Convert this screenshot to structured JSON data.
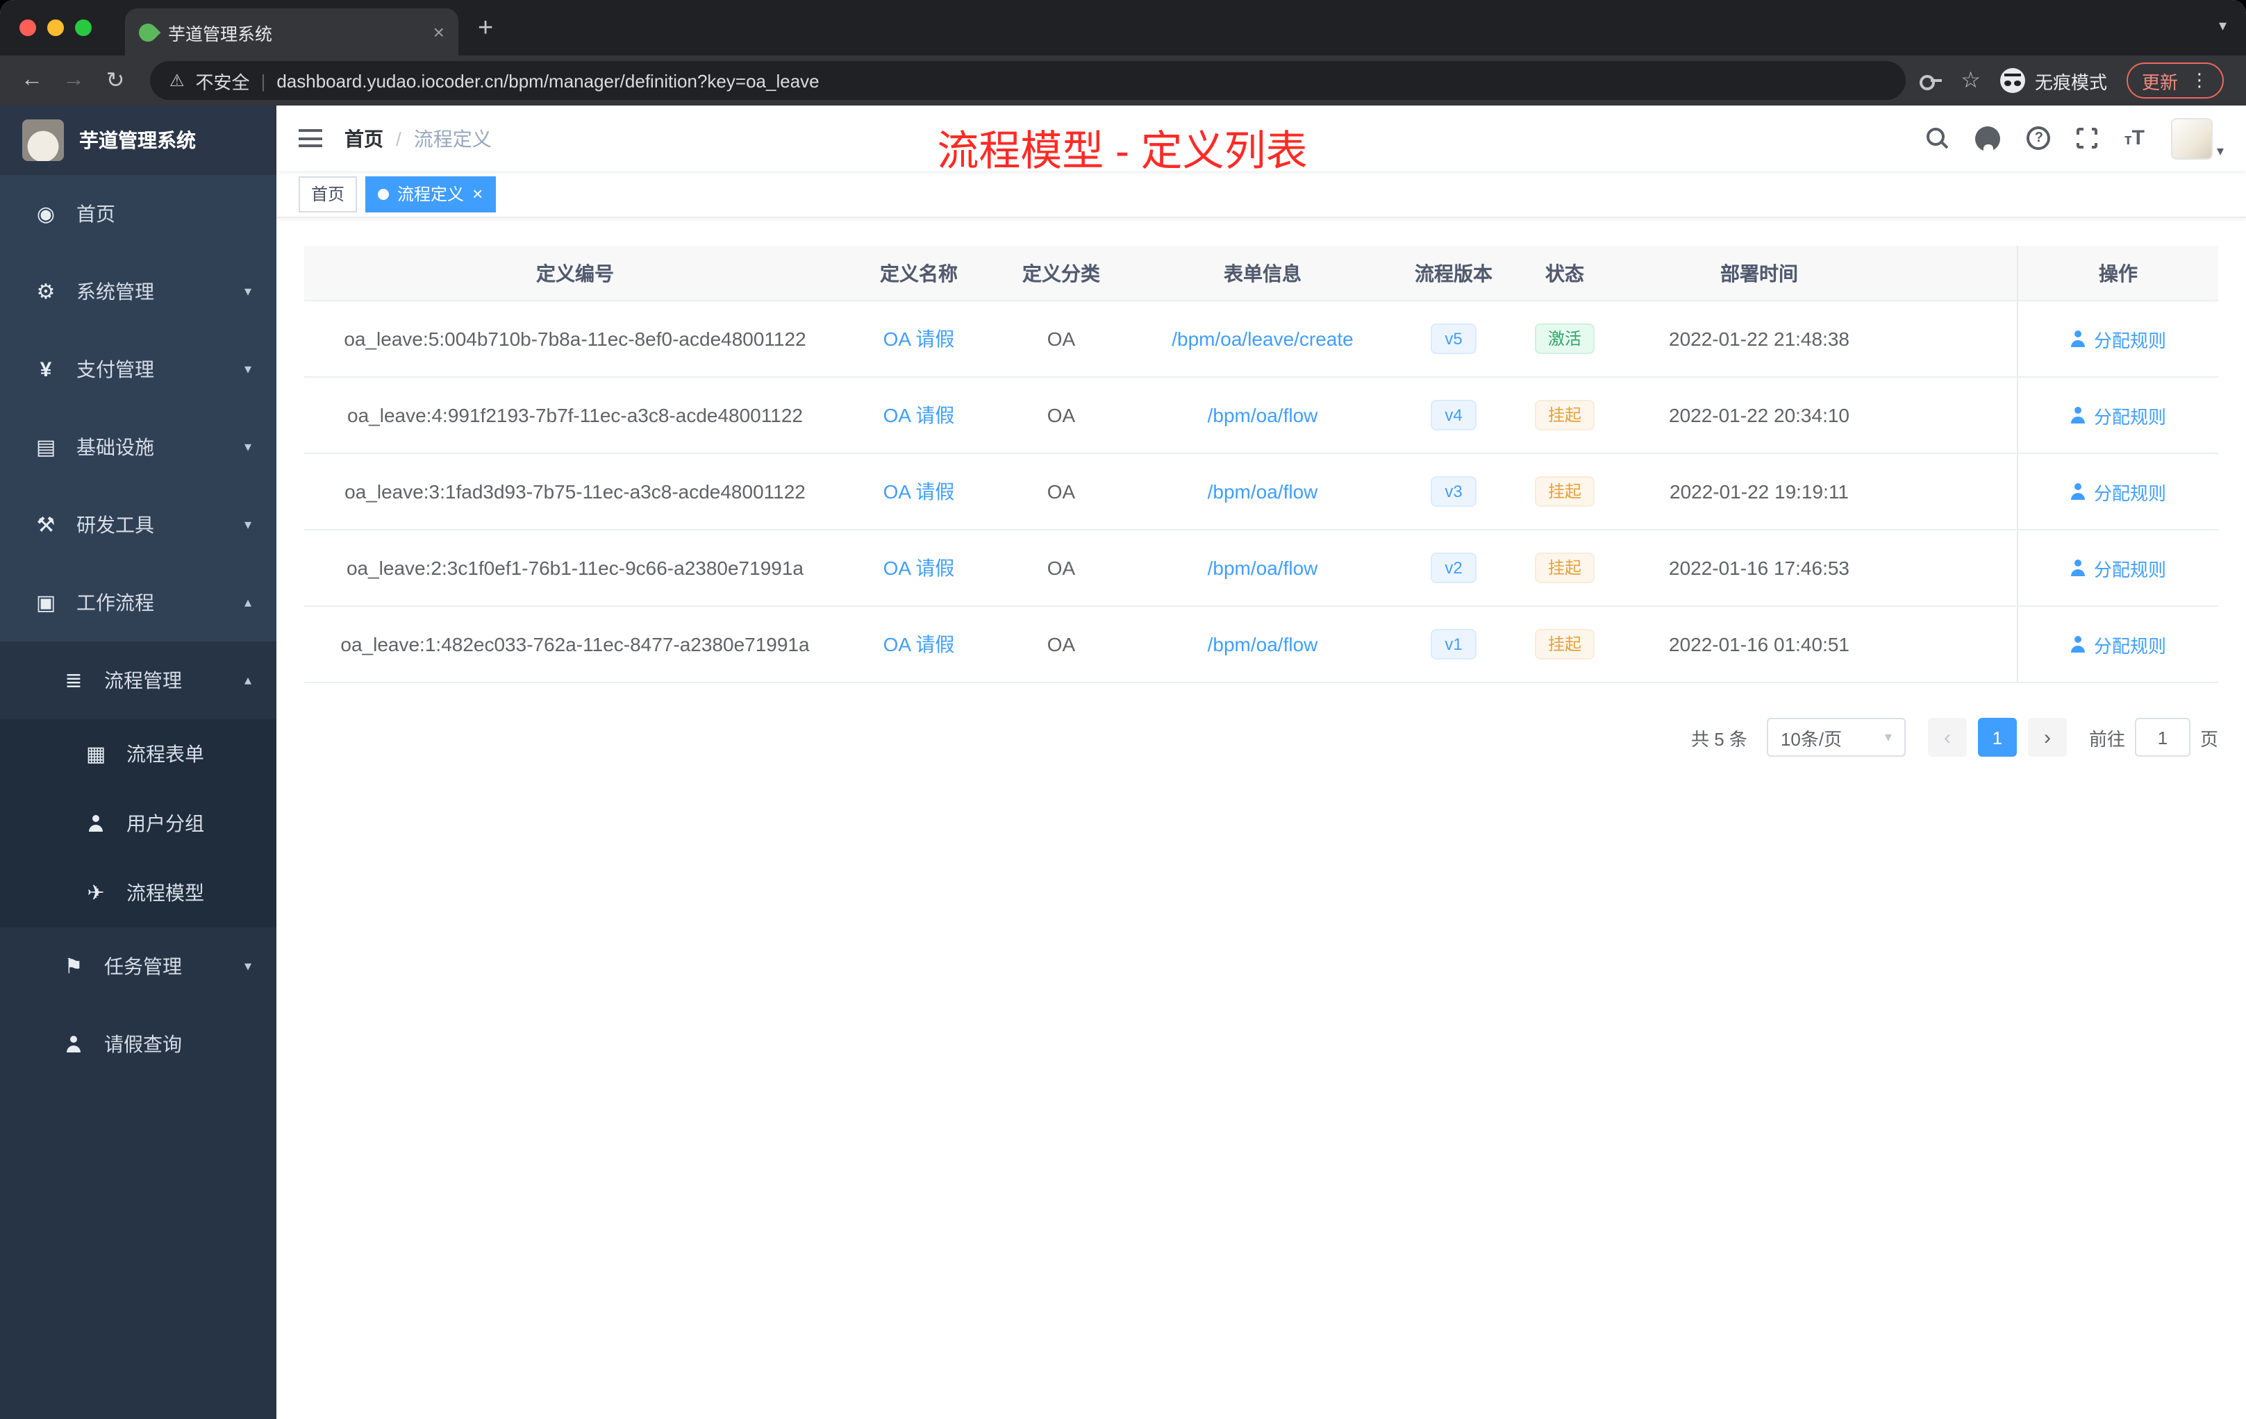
{
  "colors": {
    "accent": "#409eff",
    "success": "#2da768",
    "warning": "#e6a23c",
    "annotation": "#fe2b25",
    "sidebar_bg": "#304156"
  },
  "browser": {
    "tab_title": "芋道管理系统",
    "security_label": "不安全",
    "url": "dashboard.yudao.iocoder.cn/bpm/manager/definition?key=oa_leave",
    "incognito_label": "无痕模式",
    "update_label": "更新"
  },
  "sidebar": {
    "logo_title": "芋道管理系统",
    "items": [
      {
        "label": "首页"
      },
      {
        "label": "系统管理"
      },
      {
        "label": "支付管理"
      },
      {
        "label": "基础设施"
      },
      {
        "label": "研发工具"
      },
      {
        "label": "工作流程"
      },
      {
        "label": "流程管理"
      },
      {
        "label": "流程表单"
      },
      {
        "label": "用户分组"
      },
      {
        "label": "流程模型"
      },
      {
        "label": "任务管理"
      },
      {
        "label": "请假查询"
      }
    ]
  },
  "header": {
    "breadcrumb_home": "首页",
    "breadcrumb_sep": "/",
    "breadcrumb_current": "流程定义",
    "annotation": "流程模型 - 定义列表"
  },
  "tags": {
    "home": "首页",
    "current": "流程定义"
  },
  "table": {
    "columns": {
      "id": "定义编号",
      "name": "定义名称",
      "category": "定义分类",
      "form": "表单信息",
      "version": "流程版本",
      "status": "状态",
      "time": "部署时间",
      "action": "操作"
    },
    "rows": [
      {
        "id": "oa_leave:5:004b710b-7b8a-11ec-8ef0-acde48001122",
        "name": "OA 请假",
        "category": "OA",
        "form": "/bpm/oa/leave/create",
        "version": "v5",
        "status": "激活",
        "time": "2022-01-22 21:48:38",
        "action": "分配规则"
      },
      {
        "id": "oa_leave:4:991f2193-7b7f-11ec-a3c8-acde48001122",
        "name": "OA 请假",
        "category": "OA",
        "form": "/bpm/oa/flow",
        "version": "v4",
        "status": "挂起",
        "time": "2022-01-22 20:34:10",
        "action": "分配规则"
      },
      {
        "id": "oa_leave:3:1fad3d93-7b75-11ec-a3c8-acde48001122",
        "name": "OA 请假",
        "category": "OA",
        "form": "/bpm/oa/flow",
        "version": "v3",
        "status": "挂起",
        "time": "2022-01-22 19:19:11",
        "action": "分配规则"
      },
      {
        "id": "oa_leave:2:3c1f0ef1-76b1-11ec-9c66-a2380e71991a",
        "name": "OA 请假",
        "category": "OA",
        "form": "/bpm/oa/flow",
        "version": "v2",
        "status": "挂起",
        "time": "2022-01-16 17:46:53",
        "action": "分配规则"
      },
      {
        "id": "oa_leave:1:482ec033-762a-11ec-8477-a2380e71991a",
        "name": "OA 请假",
        "category": "OA",
        "form": "/bpm/oa/flow",
        "version": "v1",
        "status": "挂起",
        "time": "2022-01-16 01:40:51",
        "action": "分配规则"
      }
    ]
  },
  "pagination": {
    "total": "共 5 条",
    "size": "10条/页",
    "page": "1",
    "goto_prefix": "前往",
    "goto_value": "1",
    "goto_suffix": "页"
  }
}
